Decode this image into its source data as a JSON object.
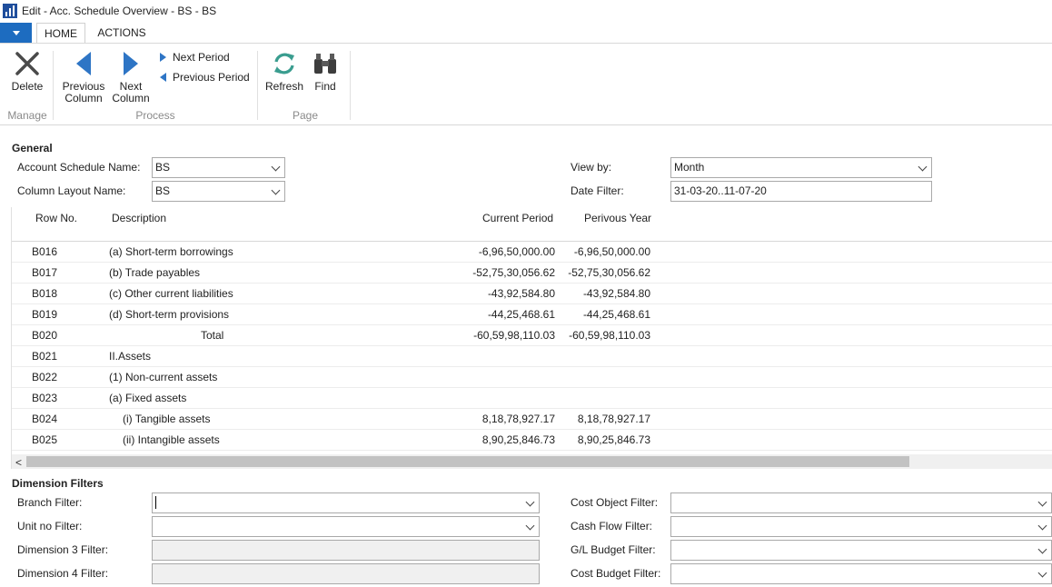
{
  "window": {
    "title": "Edit - Acc. Schedule Overview - BS - BS"
  },
  "tabs": {
    "home": "HOME",
    "actions": "ACTIONS"
  },
  "ribbon": {
    "delete": "Delete",
    "previous_column_1": "Previous",
    "previous_column_2": "Column",
    "next_column_1": "Next",
    "next_column_2": "Column",
    "next_period": "Next Period",
    "previous_period": "Previous Period",
    "refresh": "Refresh",
    "find": "Find",
    "group_manage": "Manage",
    "group_process": "Process",
    "group_page": "Page"
  },
  "general": {
    "title": "General",
    "account_schedule_name_label": "Account Schedule Name:",
    "account_schedule_name": "BS",
    "column_layout_name_label": "Column Layout Name:",
    "column_layout_name": "BS",
    "view_by_label": "View by:",
    "view_by": "Month",
    "date_filter_label": "Date Filter:",
    "date_filter": "31-03-20..11-07-20"
  },
  "grid": {
    "headers": {
      "row_no": "Row No.",
      "description": "Description",
      "current_period": "Current Period",
      "previous_year": "Perivous Year"
    },
    "rows": [
      {
        "row_no": "B016",
        "description": "(a) Short-term borrowings",
        "current_period": "-6,96,50,000.00",
        "previous_year": "-6,96,50,000.00"
      },
      {
        "row_no": "B017",
        "description": "(b) Trade payables",
        "current_period": "-52,75,30,056.62",
        "previous_year": "-52,75,30,056.62"
      },
      {
        "row_no": "B018",
        "description": "(c) Other current liabilities",
        "current_period": "-43,92,584.80",
        "previous_year": "-43,92,584.80"
      },
      {
        "row_no": "B019",
        "description": "(d) Short-term provisions",
        "current_period": "-44,25,468.61",
        "previous_year": "-44,25,468.61"
      },
      {
        "row_no": "B020",
        "description": "Total",
        "current_period": "-60,59,98,110.03",
        "previous_year": "-60,59,98,110.03"
      },
      {
        "row_no": "B021",
        "description": "II.Assets",
        "current_period": "",
        "previous_year": ""
      },
      {
        "row_no": "B022",
        "description": "(1) Non-current assets",
        "current_period": "",
        "previous_year": ""
      },
      {
        "row_no": "B023",
        "description": "(a) Fixed assets",
        "current_period": "",
        "previous_year": ""
      },
      {
        "row_no": "B024",
        "description": "(i) Tangible assets",
        "current_period": "8,18,78,927.17",
        "previous_year": "8,18,78,927.17"
      },
      {
        "row_no": "B025",
        "description": "(ii) Intangible assets",
        "current_period": "8,90,25,846.73",
        "previous_year": "8,90,25,846.73"
      }
    ]
  },
  "dimension_filters": {
    "title": "Dimension Filters",
    "branch_filter_label": "Branch Filter:",
    "unit_no_filter_label": "Unit no Filter:",
    "dimension3_filter_label": "Dimension 3 Filter:",
    "dimension4_filter_label": "Dimension 4 Filter:",
    "cost_object_filter_label": "Cost Object Filter:",
    "cash_flow_filter_label": "Cash Flow Filter:",
    "gl_budget_filter_label": "G/L Budget Filter:",
    "cost_budget_filter_label": "Cost Budget Filter:"
  },
  "scroll_left_arrow": "<",
  "colors": {
    "accent": "#1d6cc0",
    "icon_blue": "#2e75c5",
    "refresh_green": "#3a9d8f"
  }
}
